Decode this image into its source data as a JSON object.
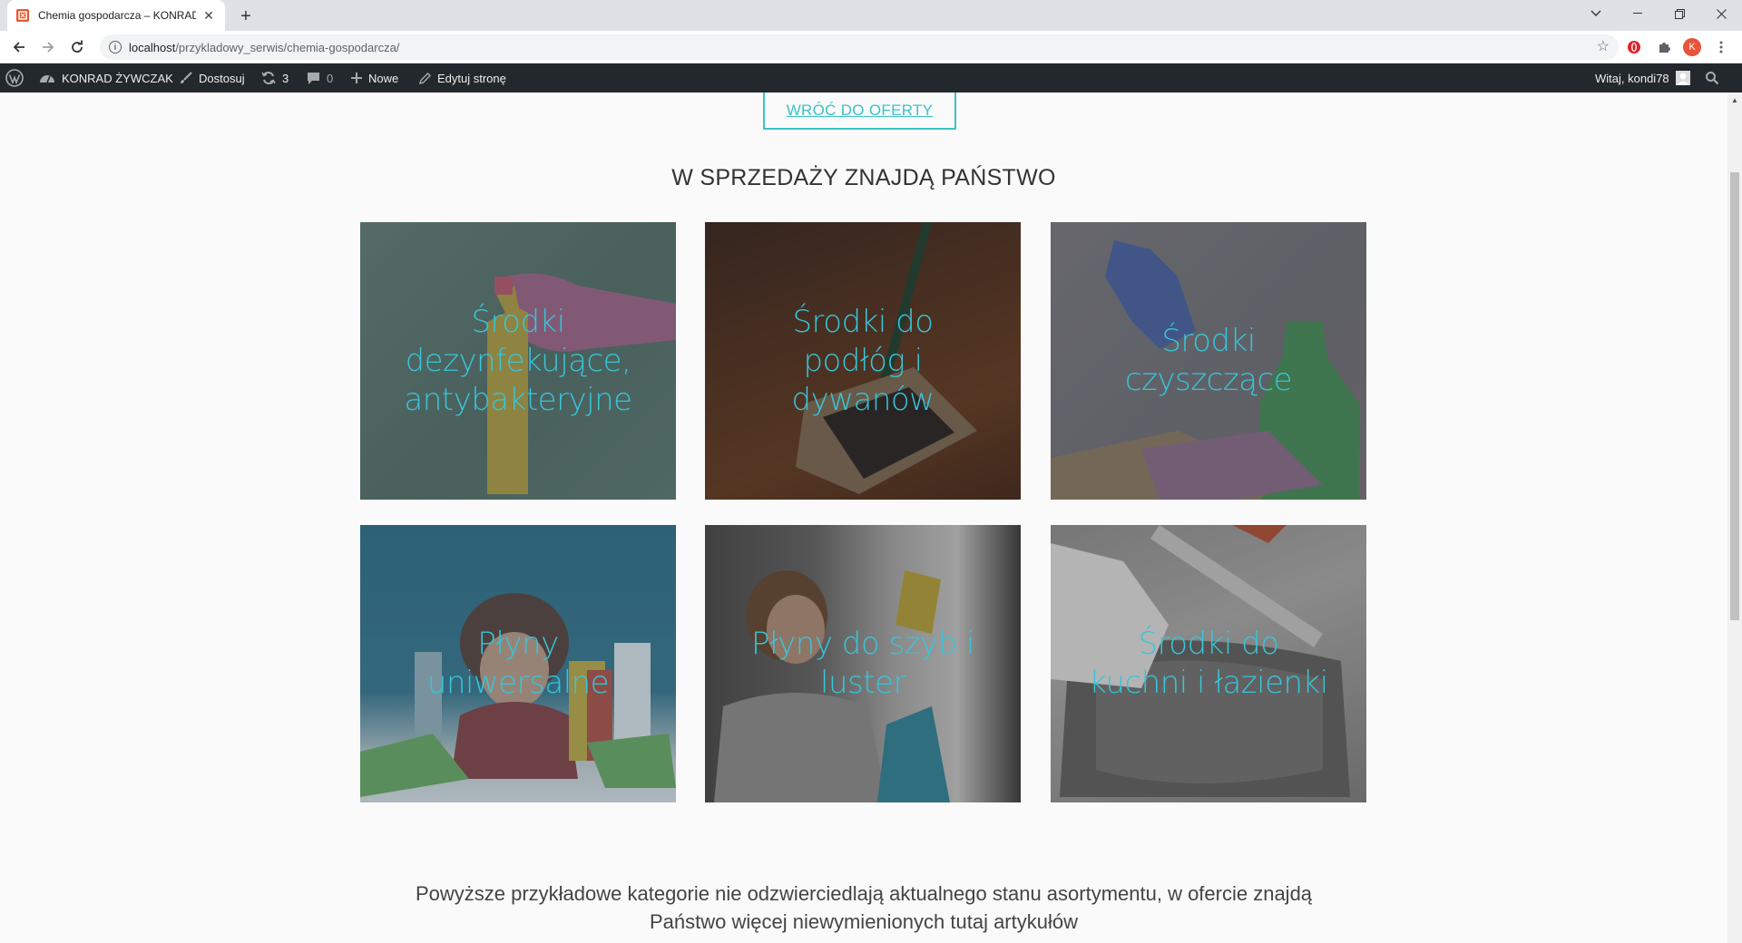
{
  "browser": {
    "tab_title": "Chemia gospodarcza – KONRAD",
    "url_host": "localhost",
    "url_path": "/przykladowy_serwis/chemia-gospodarcza/",
    "profile_initial": "K"
  },
  "adminbar": {
    "site_name": "KONRAD ŻYWCZAK",
    "customize": "Dostosuj",
    "updates_count": "3",
    "comments_count": "0",
    "new": "Nowe",
    "edit_page": "Edytuj stronę",
    "greeting": "Witaj, kondi78"
  },
  "page": {
    "back_button": "WRÓĆ DO OFERTY",
    "section_title": "W SPRZEDAŻY ZNAJDĄ PAŃSTWO",
    "categories": [
      {
        "label": "Środki dezynfekujące, antybakteryjne"
      },
      {
        "label": "Środki do podłóg i dywanów"
      },
      {
        "label": "Środki czyszczące"
      },
      {
        "label": "Płyny uniwersalne"
      },
      {
        "label": "Płyny do szyb i luster"
      },
      {
        "label": "Środki do kuchni i łazienki"
      }
    ],
    "footnote_line1": "Powyższe przykładowe kategorie nie odzwierciedlają aktualnego stanu asortymentu, w ofercie znajdą",
    "footnote_line2": "Państwo więcej niewymienionych tutaj artykułów"
  },
  "colors": {
    "accent": "#3cc1c8",
    "tile_text": "#38c5d9",
    "adminbar_bg": "#23282d"
  }
}
